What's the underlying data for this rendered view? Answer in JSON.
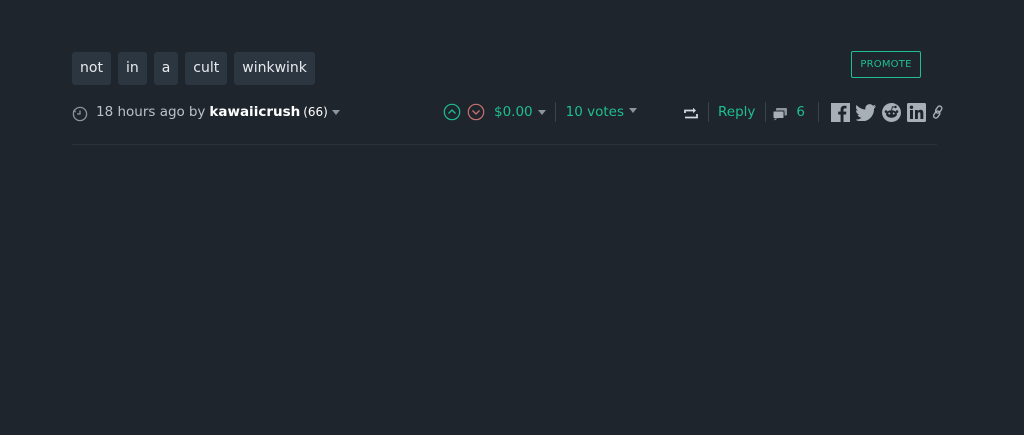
{
  "tags": [
    "not",
    "in",
    "a",
    "cult",
    "winkwink"
  ],
  "promote_label": "PROMOTE",
  "post": {
    "time_ago": "18 hours ago",
    "by_label": "by",
    "author": "kawaiicrush",
    "reputation": "(66)",
    "payout": "$0.00",
    "votes": "10 votes",
    "reply_label": "Reply",
    "comment_count": "6"
  },
  "colors": {
    "accent": "#1fbf8f",
    "downvote": "#c9736f",
    "background": "#1e252c",
    "tag_bg": "#2c3640"
  },
  "icons": [
    "clock-icon",
    "upvote-icon",
    "downvote-icon",
    "reblog-icon",
    "comments-icon",
    "facebook-icon",
    "twitter-icon",
    "reddit-icon",
    "linkedin-icon",
    "link-icon"
  ]
}
